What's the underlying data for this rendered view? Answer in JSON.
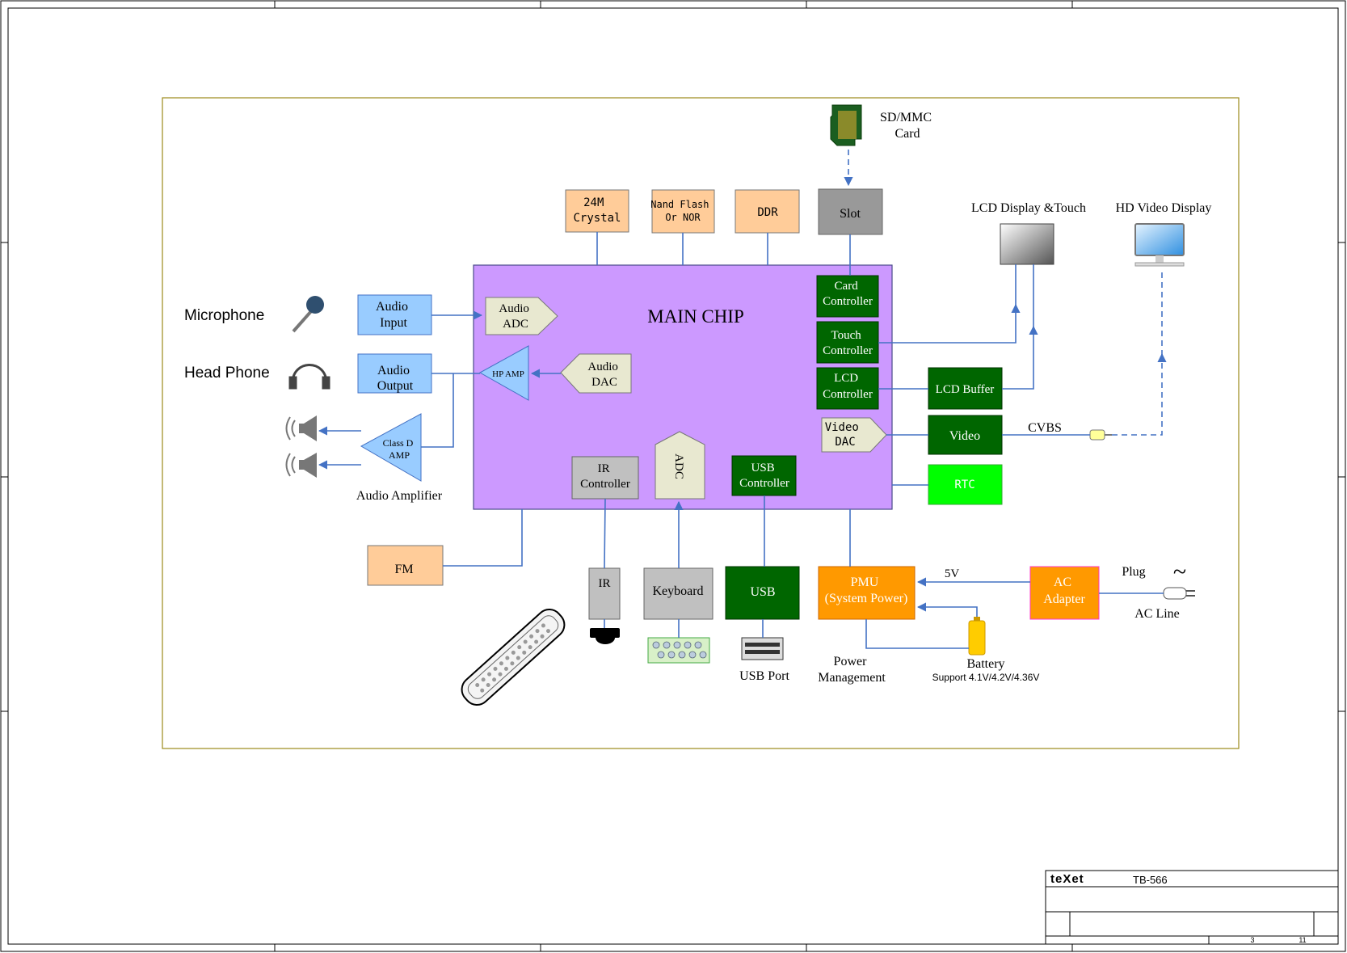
{
  "main_chip": {
    "title": "MAIN CHIP",
    "blocks": {
      "card_controller": [
        "Card",
        "Controller"
      ],
      "touch_controller": [
        "Touch",
        "Controller"
      ],
      "lcd_controller": [
        "LCD",
        "Controller"
      ],
      "video_dac": [
        "Video",
        "DAC"
      ],
      "usb_controller": [
        "USB",
        "Controller"
      ],
      "ir_controller": [
        "IR",
        "Controller"
      ],
      "adc": "ADC",
      "audio_adc": [
        "Audio",
        "ADC"
      ],
      "audio_dac": [
        "Audio",
        "DAC"
      ],
      "hp_amp": "HP AMP"
    }
  },
  "top_blocks": {
    "crystal": [
      "24M",
      "Crystal"
    ],
    "nand": [
      "Nand Flash",
      "Or NOR"
    ],
    "ddr": "DDR",
    "slot": "Slot",
    "sd_card_label": [
      "SD/MMC",
      "Card"
    ]
  },
  "audio": {
    "microphone_label": "Microphone",
    "headphone_label": "Head Phone",
    "audio_input": [
      "Audio",
      "Input"
    ],
    "audio_output": [
      "Audio",
      "Output"
    ],
    "class_d_amp": [
      "Class D",
      "AMP"
    ],
    "audio_amplifier_label": "Audio Amplifier",
    "fm": "FM"
  },
  "display": {
    "lcd_label": "LCD Display &Touch",
    "hd_label": "HD Video Display",
    "lcd_buffer": "LCD Buffer",
    "video": "Video",
    "cvbs": "CVBS",
    "rtc": "RTC"
  },
  "bottom": {
    "ir": "IR",
    "keyboard": "Keyboard",
    "usb": "USB",
    "usb_port_label": "USB Port",
    "pmu": [
      "PMU",
      "(System Power)"
    ],
    "power_mgmt_label": [
      "Power",
      "Management"
    ],
    "battery_label": "Battery",
    "battery_support": "Support 4.1V/4.2V/4.36V",
    "five_v": "5V",
    "ac_adapter": [
      "AC",
      "Adapter"
    ],
    "plug_label": "Plug",
    "ac_line_label": "AC Line",
    "tilde": "~"
  },
  "title_block": {
    "brand": "teXet",
    "model": "TB-566",
    "sheet": "3",
    "of_sheets": "11"
  },
  "colors": {
    "chip": "#cc99ff",
    "dark_green": "#006600",
    "bright_green": "#00ff00",
    "light_blue": "#99ccff",
    "peach": "#ffcc99",
    "gray": "#999999",
    "light_gray": "#c0c0c0",
    "orange": "#ff9900",
    "beige": "#e8e8d0",
    "line_blue": "#4472c4",
    "frame_olive": "#9b8a1a"
  }
}
